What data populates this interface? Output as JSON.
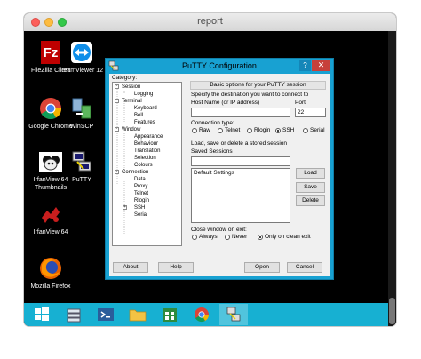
{
  "window": {
    "title": "report"
  },
  "desktop_icons": [
    {
      "label": "FileZilla Client",
      "icon": "filezilla-icon"
    },
    {
      "label": "TeamViewer 12",
      "icon": "teamviewer-icon"
    },
    {
      "label": "Google Chrome",
      "icon": "chrome-icon"
    },
    {
      "label": "WinSCP",
      "icon": "winscp-icon"
    },
    {
      "label": "IrfanView 64 Thumbnails",
      "icon": "irfanview-thumbnails-icon"
    },
    {
      "label": "PuTTY",
      "icon": "putty-icon"
    },
    {
      "label": "IrfanView 64",
      "icon": "irfanview-icon"
    },
    {
      "label": "Mozilla Firefox",
      "icon": "firefox-icon"
    }
  ],
  "putty": {
    "title": "PuTTY Configuration",
    "help_btn": "?",
    "close_btn": "✕",
    "category_label": "Category:",
    "tree": [
      {
        "label": "Session",
        "level": 0,
        "expanded": true
      },
      {
        "label": "Logging",
        "level": 1
      },
      {
        "label": "Terminal",
        "level": 0,
        "expanded": true
      },
      {
        "label": "Keyboard",
        "level": 1
      },
      {
        "label": "Bell",
        "level": 1
      },
      {
        "label": "Features",
        "level": 1
      },
      {
        "label": "Window",
        "level": 0,
        "expanded": true
      },
      {
        "label": "Appearance",
        "level": 1
      },
      {
        "label": "Behaviour",
        "level": 1
      },
      {
        "label": "Translation",
        "level": 1
      },
      {
        "label": "Selection",
        "level": 1
      },
      {
        "label": "Colours",
        "level": 1
      },
      {
        "label": "Connection",
        "level": 0,
        "expanded": true
      },
      {
        "label": "Data",
        "level": 1
      },
      {
        "label": "Proxy",
        "level": 1
      },
      {
        "label": "Telnet",
        "level": 1
      },
      {
        "label": "Rlogin",
        "level": 1
      },
      {
        "label": "SSH",
        "level": 1,
        "expandable": true
      },
      {
        "label": "Serial",
        "level": 1
      }
    ],
    "header": "Basic options for your PuTTY session",
    "destination_label": "Specify the destination you want to connect to",
    "host_label": "Host Name (or IP address)",
    "host_value": "",
    "port_label": "Port",
    "port_value": "22",
    "conn_type_label": "Connection type:",
    "conn_types": [
      "Raw",
      "Telnet",
      "Rlogin",
      "SSH",
      "Serial"
    ],
    "conn_type_selected": "SSH",
    "load_save_label": "Load, save or delete a stored session",
    "saved_sessions_label": "Saved Sessions",
    "saved_sessions_value": "",
    "sessions": [
      "Default Settings"
    ],
    "load_btn": "Load",
    "save_btn": "Save",
    "delete_btn": "Delete",
    "close_exit_label": "Close window on exit:",
    "close_exit_options": [
      "Always",
      "Never",
      "Only on clean exit"
    ],
    "close_exit_selected": "Only on clean exit",
    "about_btn": "About",
    "help_button": "Help",
    "open_btn": "Open",
    "cancel_btn": "Cancel"
  },
  "taskbar": {
    "items": [
      "windows-start-icon",
      "server-manager-icon",
      "powershell-icon",
      "file-explorer-icon",
      "store-icon",
      "chrome-icon",
      "putty-icon"
    ],
    "active": "putty-icon"
  }
}
